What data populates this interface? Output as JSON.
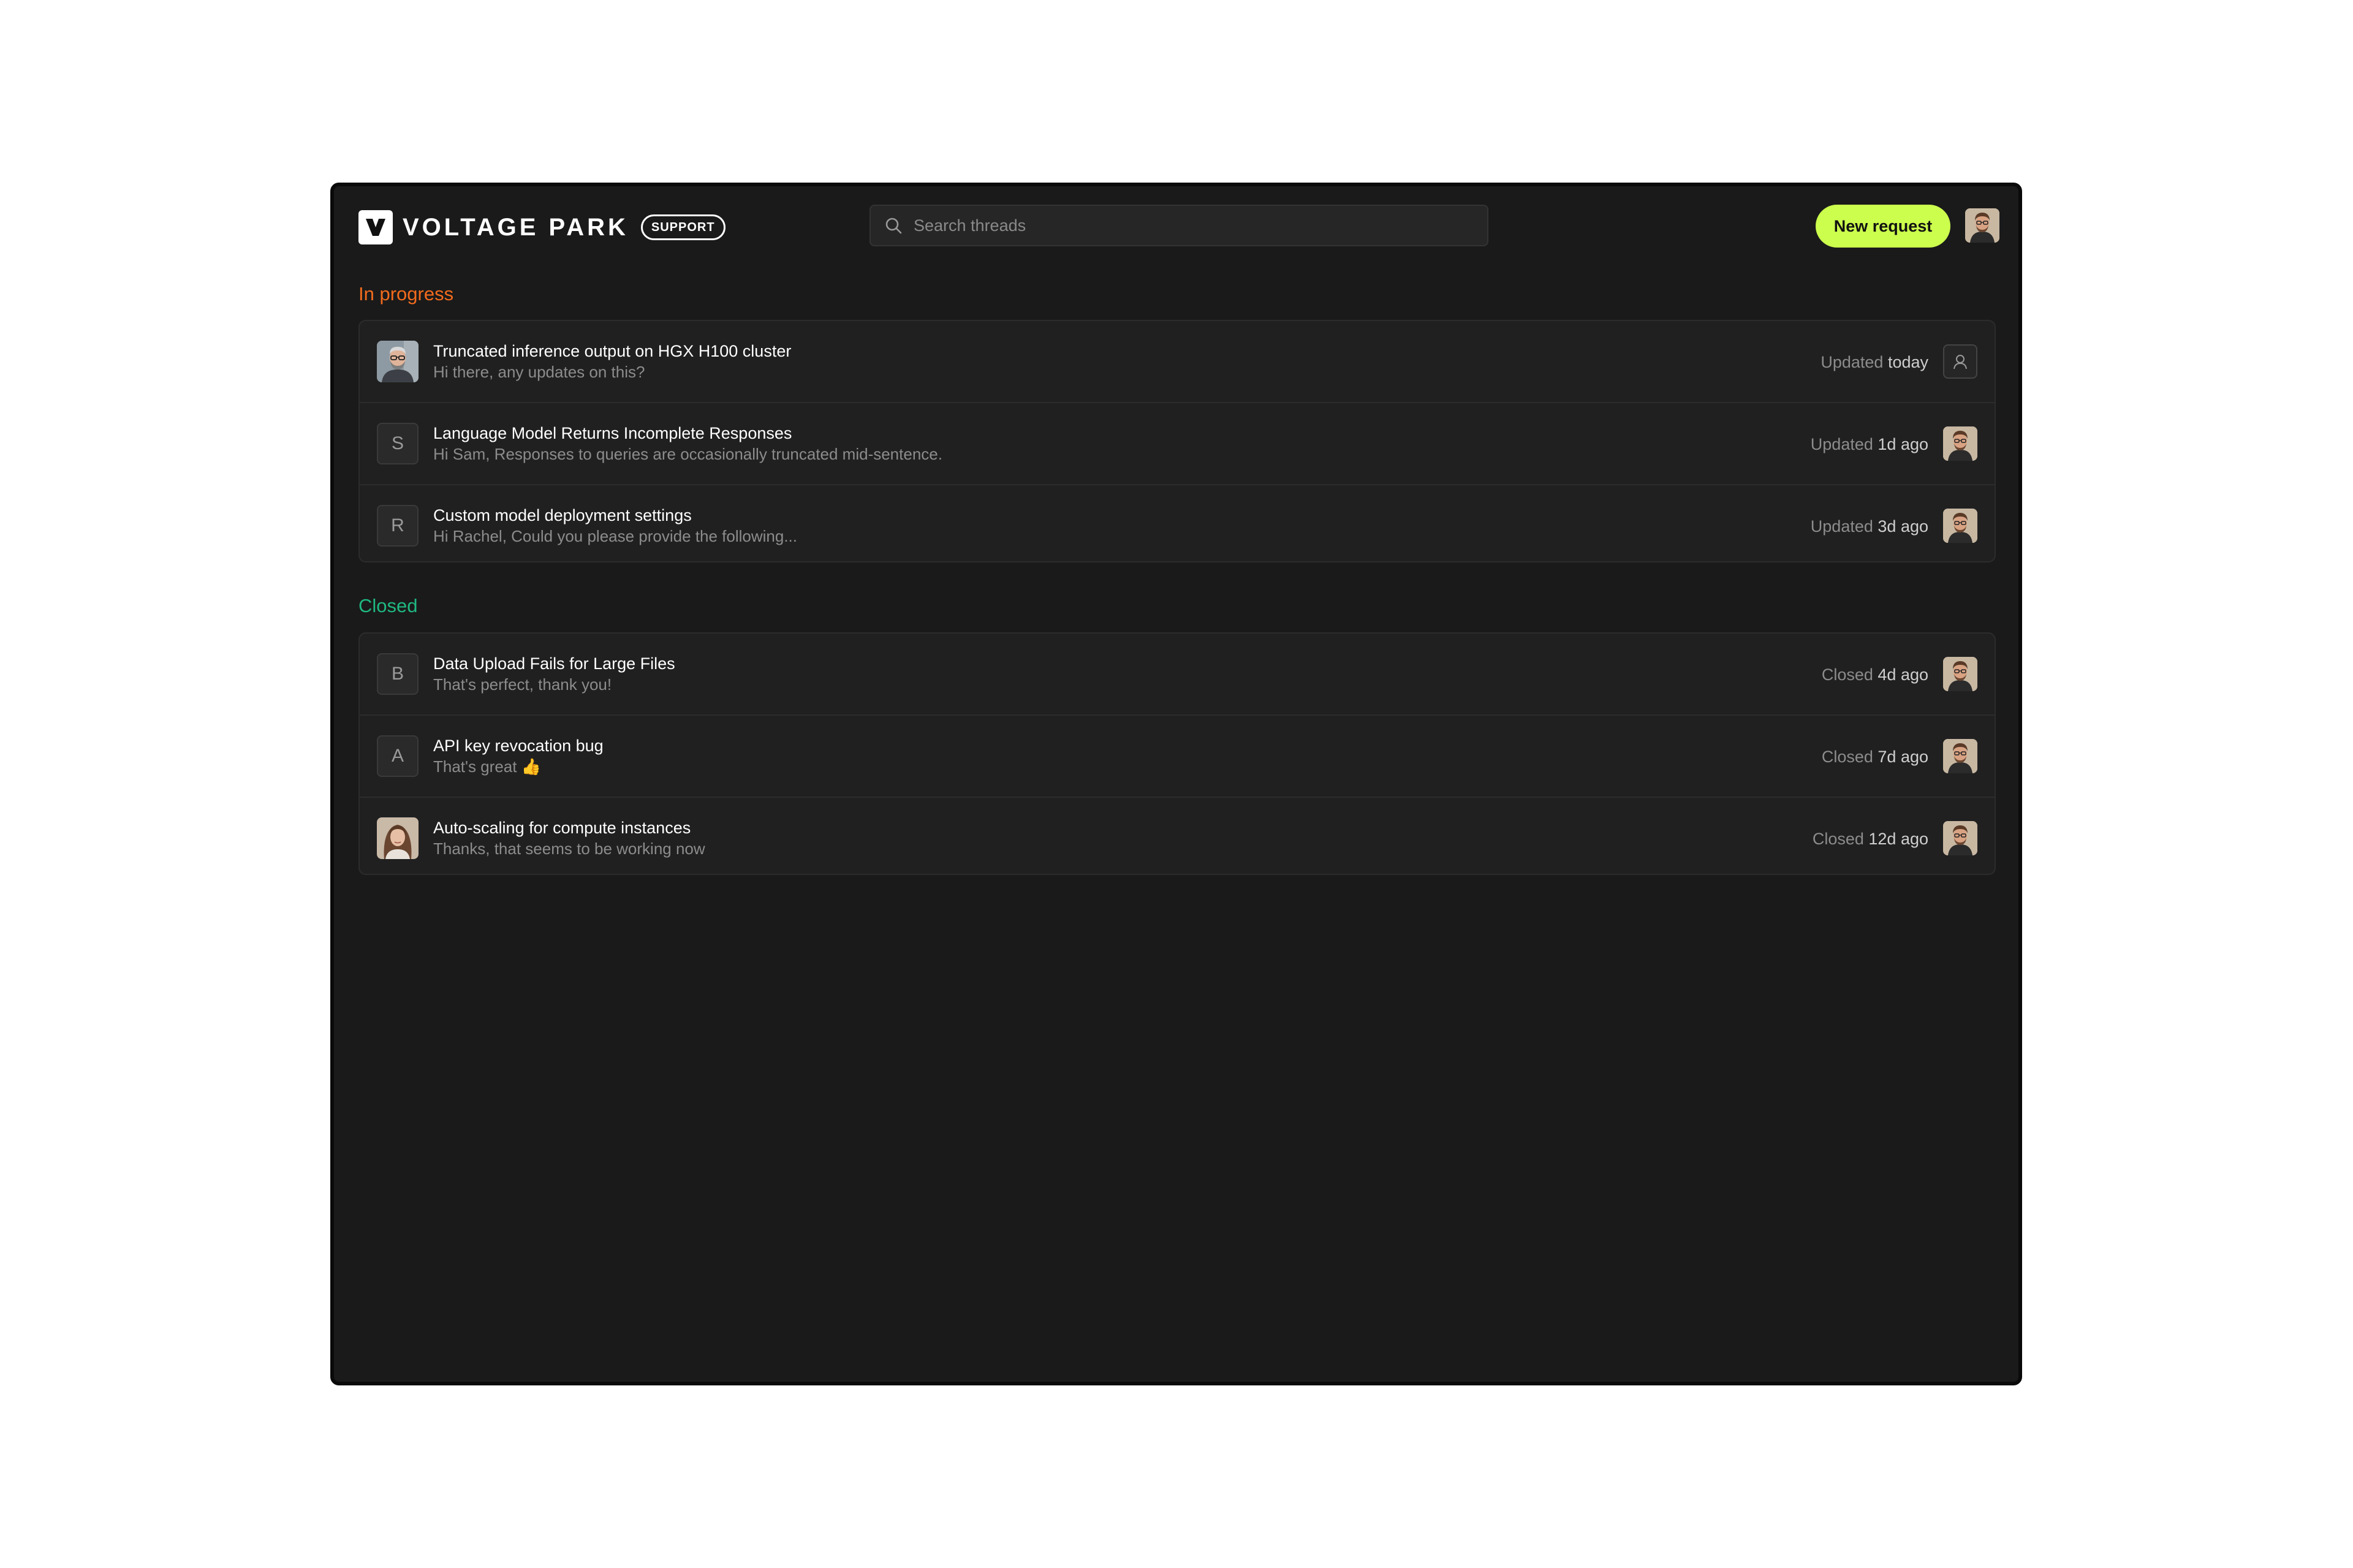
{
  "brand": {
    "name": "VOLTAGE PARK",
    "badge": "SUPPORT"
  },
  "search": {
    "placeholder": "Search threads"
  },
  "actions": {
    "new_request": "New request"
  },
  "sections": {
    "in_progress": {
      "title": "In progress",
      "threads": [
        {
          "title": "Truncated inference output on HGX H100 cluster",
          "preview": "Hi there, any updates on this?",
          "status_label": "Updated",
          "time": "today",
          "thumb": "photo-man-glasses",
          "assignee": "unassigned-icon"
        },
        {
          "title": "Language Model Returns Incomplete Responses",
          "preview": "Hi Sam, Responses to queries are occasionally truncated mid-sentence.",
          "status_label": "Updated",
          "time": "1d ago",
          "initial": "S",
          "assignee": "agent-avatar"
        },
        {
          "title": "Custom model deployment settings",
          "preview": "Hi Rachel, Could you please provide the following...",
          "status_label": "Updated",
          "time": "3d ago",
          "initial": "R",
          "assignee": "agent-avatar"
        }
      ]
    },
    "closed": {
      "title": "Closed",
      "threads": [
        {
          "title": "Data Upload Fails for Large Files",
          "preview": "That's perfect, thank you!",
          "status_label": "Closed",
          "time": "4d ago",
          "initial": "B",
          "assignee": "agent-avatar"
        },
        {
          "title": "API key revocation bug",
          "preview": "That's great 👍",
          "status_label": "Closed",
          "time": "7d ago",
          "initial": "A",
          "assignee": "agent-avatar"
        },
        {
          "title": "Auto-scaling for compute instances",
          "preview": "Thanks, that seems to be working now",
          "status_label": "Closed",
          "time": "12d ago",
          "thumb": "photo-woman",
          "assignee": "agent-avatar"
        }
      ]
    }
  },
  "colors": {
    "accent": "#ccff4d",
    "in_progress": "#f26b1d",
    "closed": "#1fb881",
    "background": "#1a1a1a"
  }
}
